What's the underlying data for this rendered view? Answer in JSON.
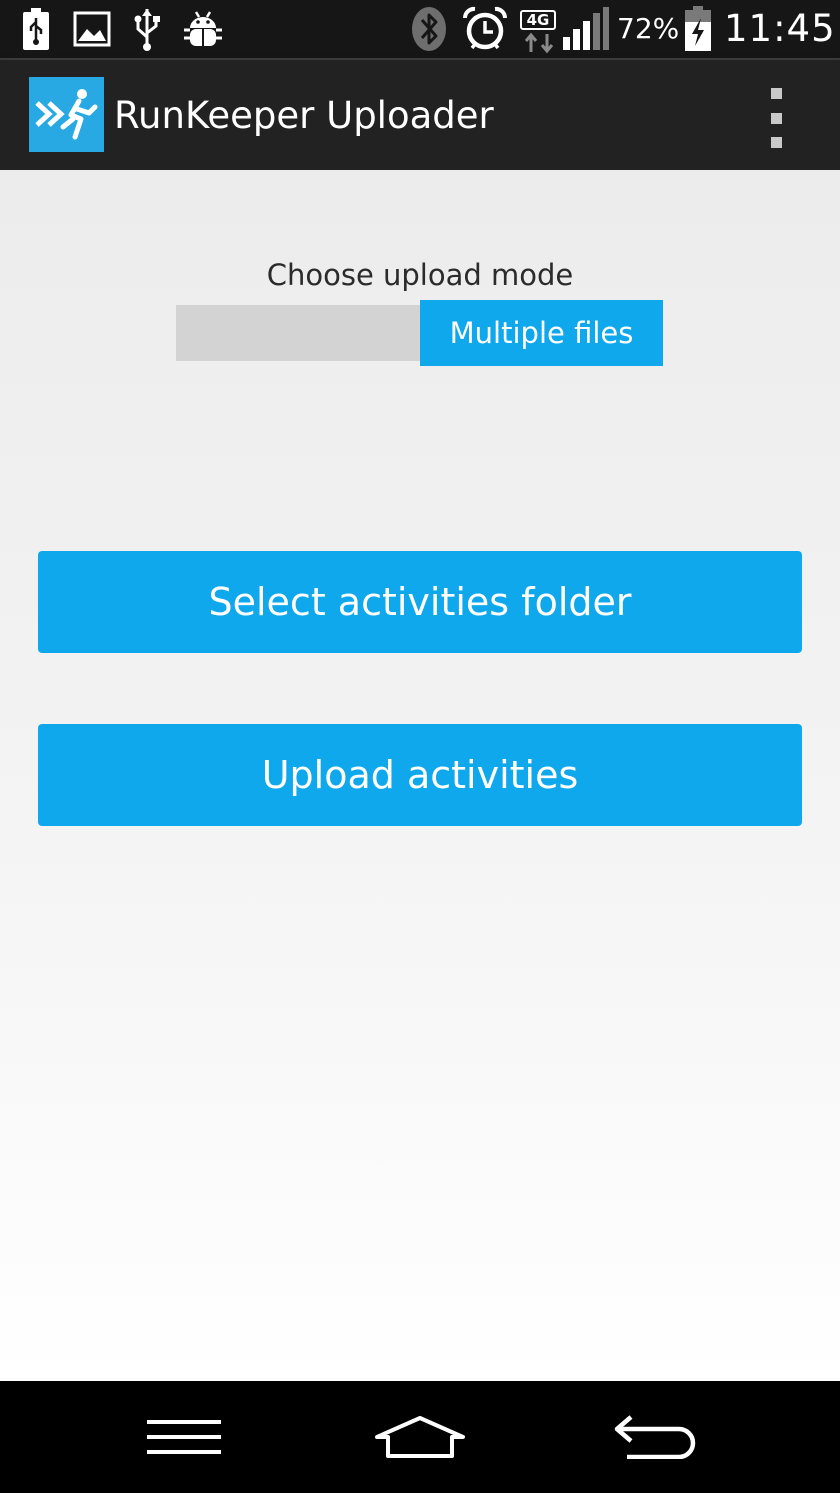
{
  "status_bar": {
    "left_icons": [
      "usb-battery-icon",
      "gallery-icon",
      "usb-icon",
      "android-debug-icon"
    ],
    "right_icons": [
      "bluetooth-icon",
      "alarm-icon",
      "network-4g-icon",
      "signal-icon",
      "battery-charging-icon"
    ],
    "network_type": "4G",
    "battery_percent": "72%",
    "clock": "11:45"
  },
  "action_bar": {
    "app_icon": "runkeeper-logo-icon",
    "title": "RunKeeper Uploader",
    "overflow_icon": "overflow-menu-icon"
  },
  "main": {
    "mode_label": "Choose upload mode",
    "mode_toggle": {
      "off_label": "",
      "on_label": "Multiple files"
    },
    "select_button_label": "Select activities folder",
    "upload_button_label": "Upload activities"
  },
  "nav_bar": {
    "icons": [
      "menu-icon",
      "home-icon",
      "back-icon"
    ]
  },
  "colors": {
    "accent": "#10a8ec",
    "logo_bg": "#29a9e4",
    "action_bar": "#222222",
    "status_bar": "#161616",
    "toggle_off": "#d3d3d3"
  }
}
